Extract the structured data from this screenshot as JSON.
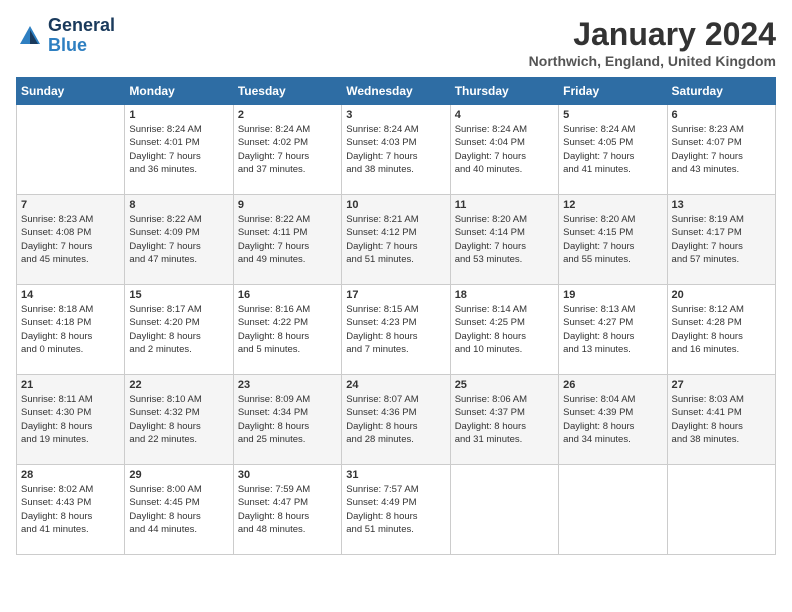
{
  "header": {
    "logo_general": "General",
    "logo_blue": "Blue",
    "month_year": "January 2024",
    "location": "Northwich, England, United Kingdom"
  },
  "weekdays": [
    "Sunday",
    "Monday",
    "Tuesday",
    "Wednesday",
    "Thursday",
    "Friday",
    "Saturday"
  ],
  "weeks": [
    [
      {
        "day": "",
        "info": ""
      },
      {
        "day": "1",
        "info": "Sunrise: 8:24 AM\nSunset: 4:01 PM\nDaylight: 7 hours\nand 36 minutes."
      },
      {
        "day": "2",
        "info": "Sunrise: 8:24 AM\nSunset: 4:02 PM\nDaylight: 7 hours\nand 37 minutes."
      },
      {
        "day": "3",
        "info": "Sunrise: 8:24 AM\nSunset: 4:03 PM\nDaylight: 7 hours\nand 38 minutes."
      },
      {
        "day": "4",
        "info": "Sunrise: 8:24 AM\nSunset: 4:04 PM\nDaylight: 7 hours\nand 40 minutes."
      },
      {
        "day": "5",
        "info": "Sunrise: 8:24 AM\nSunset: 4:05 PM\nDaylight: 7 hours\nand 41 minutes."
      },
      {
        "day": "6",
        "info": "Sunrise: 8:23 AM\nSunset: 4:07 PM\nDaylight: 7 hours\nand 43 minutes."
      }
    ],
    [
      {
        "day": "7",
        "info": "Sunrise: 8:23 AM\nSunset: 4:08 PM\nDaylight: 7 hours\nand 45 minutes."
      },
      {
        "day": "8",
        "info": "Sunrise: 8:22 AM\nSunset: 4:09 PM\nDaylight: 7 hours\nand 47 minutes."
      },
      {
        "day": "9",
        "info": "Sunrise: 8:22 AM\nSunset: 4:11 PM\nDaylight: 7 hours\nand 49 minutes."
      },
      {
        "day": "10",
        "info": "Sunrise: 8:21 AM\nSunset: 4:12 PM\nDaylight: 7 hours\nand 51 minutes."
      },
      {
        "day": "11",
        "info": "Sunrise: 8:20 AM\nSunset: 4:14 PM\nDaylight: 7 hours\nand 53 minutes."
      },
      {
        "day": "12",
        "info": "Sunrise: 8:20 AM\nSunset: 4:15 PM\nDaylight: 7 hours\nand 55 minutes."
      },
      {
        "day": "13",
        "info": "Sunrise: 8:19 AM\nSunset: 4:17 PM\nDaylight: 7 hours\nand 57 minutes."
      }
    ],
    [
      {
        "day": "14",
        "info": "Sunrise: 8:18 AM\nSunset: 4:18 PM\nDaylight: 8 hours\nand 0 minutes."
      },
      {
        "day": "15",
        "info": "Sunrise: 8:17 AM\nSunset: 4:20 PM\nDaylight: 8 hours\nand 2 minutes."
      },
      {
        "day": "16",
        "info": "Sunrise: 8:16 AM\nSunset: 4:22 PM\nDaylight: 8 hours\nand 5 minutes."
      },
      {
        "day": "17",
        "info": "Sunrise: 8:15 AM\nSunset: 4:23 PM\nDaylight: 8 hours\nand 7 minutes."
      },
      {
        "day": "18",
        "info": "Sunrise: 8:14 AM\nSunset: 4:25 PM\nDaylight: 8 hours\nand 10 minutes."
      },
      {
        "day": "19",
        "info": "Sunrise: 8:13 AM\nSunset: 4:27 PM\nDaylight: 8 hours\nand 13 minutes."
      },
      {
        "day": "20",
        "info": "Sunrise: 8:12 AM\nSunset: 4:28 PM\nDaylight: 8 hours\nand 16 minutes."
      }
    ],
    [
      {
        "day": "21",
        "info": "Sunrise: 8:11 AM\nSunset: 4:30 PM\nDaylight: 8 hours\nand 19 minutes."
      },
      {
        "day": "22",
        "info": "Sunrise: 8:10 AM\nSunset: 4:32 PM\nDaylight: 8 hours\nand 22 minutes."
      },
      {
        "day": "23",
        "info": "Sunrise: 8:09 AM\nSunset: 4:34 PM\nDaylight: 8 hours\nand 25 minutes."
      },
      {
        "day": "24",
        "info": "Sunrise: 8:07 AM\nSunset: 4:36 PM\nDaylight: 8 hours\nand 28 minutes."
      },
      {
        "day": "25",
        "info": "Sunrise: 8:06 AM\nSunset: 4:37 PM\nDaylight: 8 hours\nand 31 minutes."
      },
      {
        "day": "26",
        "info": "Sunrise: 8:04 AM\nSunset: 4:39 PM\nDaylight: 8 hours\nand 34 minutes."
      },
      {
        "day": "27",
        "info": "Sunrise: 8:03 AM\nSunset: 4:41 PM\nDaylight: 8 hours\nand 38 minutes."
      }
    ],
    [
      {
        "day": "28",
        "info": "Sunrise: 8:02 AM\nSunset: 4:43 PM\nDaylight: 8 hours\nand 41 minutes."
      },
      {
        "day": "29",
        "info": "Sunrise: 8:00 AM\nSunset: 4:45 PM\nDaylight: 8 hours\nand 44 minutes."
      },
      {
        "day": "30",
        "info": "Sunrise: 7:59 AM\nSunset: 4:47 PM\nDaylight: 8 hours\nand 48 minutes."
      },
      {
        "day": "31",
        "info": "Sunrise: 7:57 AM\nSunset: 4:49 PM\nDaylight: 8 hours\nand 51 minutes."
      },
      {
        "day": "",
        "info": ""
      },
      {
        "day": "",
        "info": ""
      },
      {
        "day": "",
        "info": ""
      }
    ]
  ]
}
